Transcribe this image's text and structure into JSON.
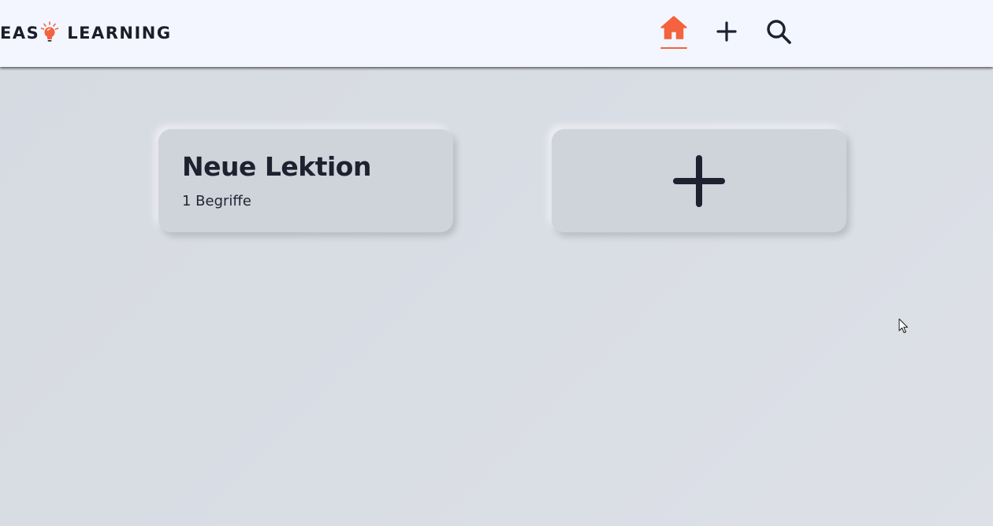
{
  "header": {
    "logo": {
      "part1": "EAS",
      "icon": "lightbulb-icon",
      "part2": "LEARNING"
    },
    "nav": [
      {
        "name": "home",
        "icon": "home-icon",
        "active": true
      },
      {
        "name": "add",
        "icon": "plus-icon",
        "active": false
      },
      {
        "name": "search",
        "icon": "search-icon",
        "active": false
      }
    ]
  },
  "lessons": [
    {
      "title": "Neue Lektion",
      "count_label": "1 Begriffe"
    }
  ],
  "add_card": {
    "icon": "plus-icon"
  },
  "colors": {
    "accent": "#f4623f",
    "header_bg": "#f3f6ff",
    "page_bg": "#d9dde4",
    "card_bg": "#cfd3da",
    "text_dark": "#1c2230"
  }
}
